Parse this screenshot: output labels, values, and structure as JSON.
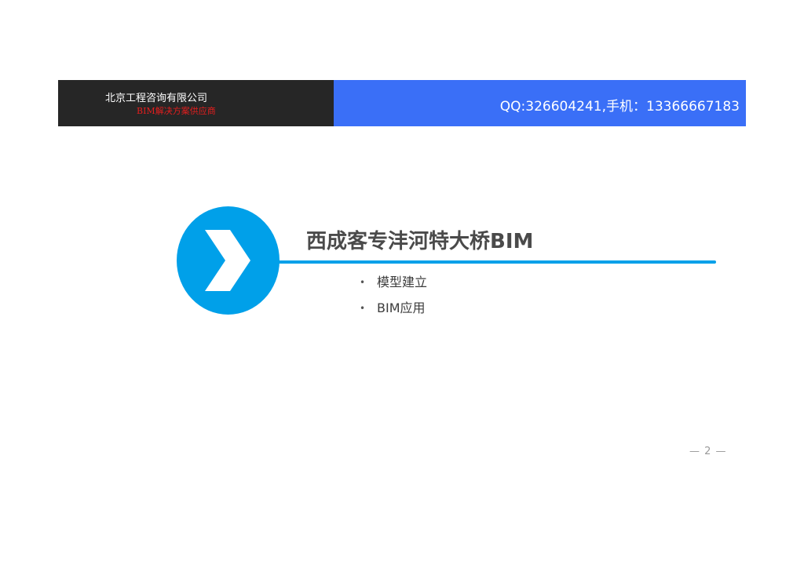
{
  "header": {
    "company_name": "北京工程咨询有限公司",
    "company_slogan": "BIM解决方案供应商",
    "contact": "QQ:326604241,手机：13366667183"
  },
  "main": {
    "badge_icon": "chevron-right-icon",
    "title": "西成客专沣河特大桥BIM",
    "bullets": [
      {
        "bullet": "•",
        "label": "模型建立"
      },
      {
        "bullet": "•",
        "label": "BIM应用"
      }
    ]
  },
  "footer": {
    "page_number": "— 2 —"
  },
  "colors": {
    "header_left_bg": "#262626",
    "header_right_bg": "#3a6ff7",
    "accent": "#00a0e9",
    "slogan_red": "#e31e1e"
  }
}
